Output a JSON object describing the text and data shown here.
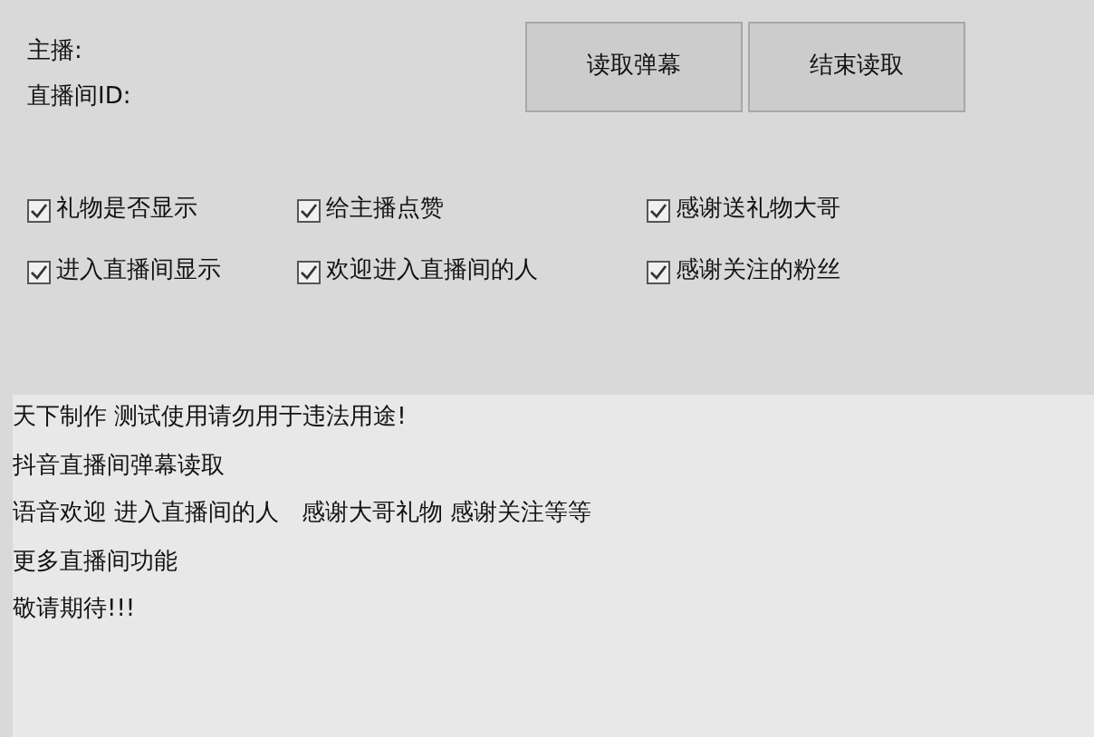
{
  "fields": [
    {
      "label": "主播:"
    },
    {
      "label": "直播间ID:"
    }
  ],
  "buttons": [
    "读取弹幕",
    "结束读取"
  ],
  "options": [
    {
      "label": "礼物是否显示",
      "checked": true
    },
    {
      "label": "给主播点赞",
      "checked": true
    },
    {
      "label": "感谢送礼物大哥",
      "checked": true
    },
    {
      "label": "进入直播间显示",
      "checked": true
    },
    {
      "label": "欢迎进入直播间的人",
      "checked": true
    },
    {
      "label": "感谢关注的粉丝",
      "checked": true
    }
  ],
  "log": [
    "天下制作 测试使用请勿用于违法用途!",
    "抖音直播间弹幕读取",
    "语音欢迎 进入直播间的人   感谢大哥礼物 感谢关注等等",
    "更多直播间功能",
    "敬请期待!!!"
  ]
}
